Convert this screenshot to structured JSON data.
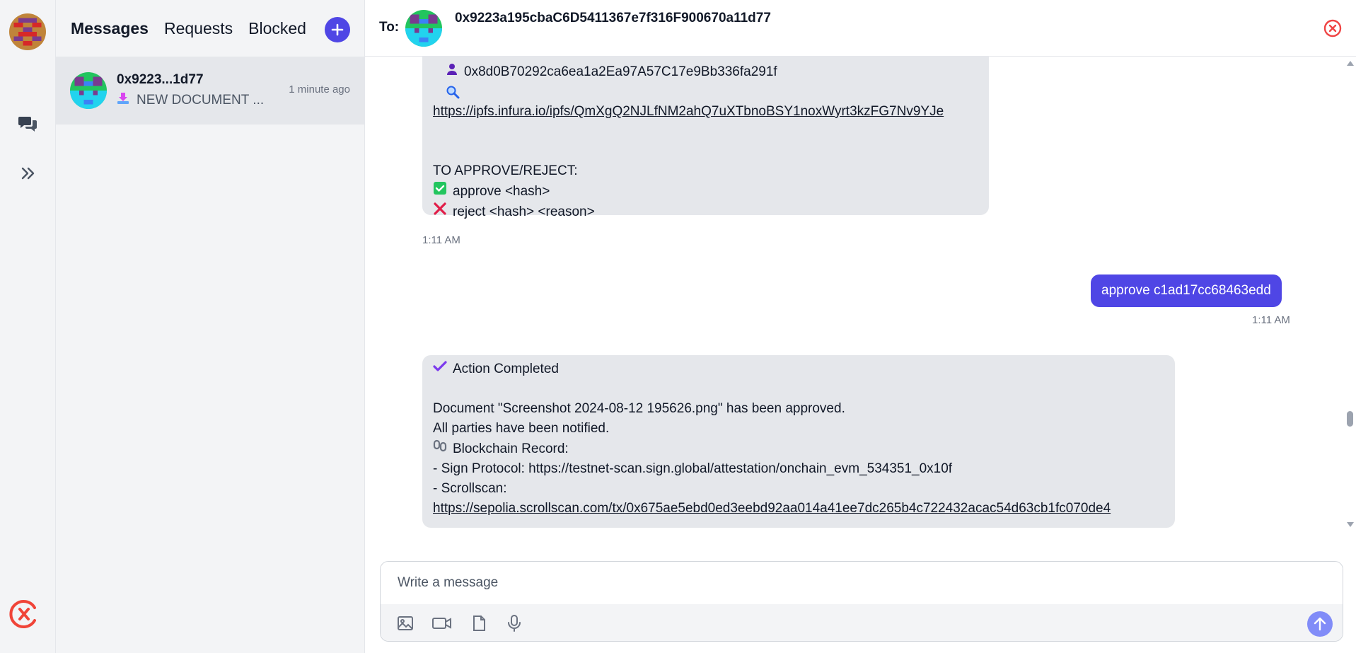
{
  "sidebar": {
    "icons": [
      "user-avatar",
      "chat-bubbles-icon",
      "chevrons-right-icon",
      "xmtp-logo"
    ]
  },
  "conversations": {
    "tabs": [
      "Messages",
      "Requests",
      "Blocked"
    ],
    "active_tab": "Messages",
    "items": [
      {
        "name": "0x9223...1d77",
        "preview": "NEW DOCUMENT ...",
        "time": "1 minute ago"
      }
    ]
  },
  "chat": {
    "to_label": "To:",
    "recipient_address": "0x9223a195cbaC6D5411367e7f316F900670a11d77",
    "messages": [
      {
        "direction": "incoming",
        "signer": "0x8d0B70292ca6ea1a2Ea97A57C17e9Bb336fa291f",
        "link": "https://ipfs.infura.io/ipfs/QmXgQ2NJLfNM2ahQ7uXTbnoBSY1noxWyrt3kzFG7Nv9YJe",
        "instructions_title": "TO APPROVE/REJECT:",
        "approve_line": "approve <hash>",
        "reject_line": "reject <hash> <reason>",
        "time": "1:11 AM"
      },
      {
        "direction": "outgoing",
        "text": "approve c1ad17cc68463edd",
        "time": "1:11 AM"
      },
      {
        "direction": "incoming",
        "title": "Action Completed",
        "line1": "Document \"Screenshot 2024-08-12 195626.png\" has been approved.",
        "line2": "All parties have been notified.",
        "record_label": "Blockchain Record:",
        "sign_protocol": "- Sign Protocol: https://testnet-scan.sign.global/attestation/onchain_evm_534351_0x10f",
        "scrollscan_label": "- Scrollscan:",
        "scrollscan_link": "https://sepolia.scrollscan.com/tx/0x675ae5ebd0ed3eebd92aa014a41ee7dc265b4c722432acac54d63cb1fc070de4"
      }
    ],
    "scroll_position": 0.7
  },
  "composer": {
    "placeholder": "Write a message",
    "tools": [
      "image-icon",
      "video-icon",
      "file-icon",
      "microphone-icon"
    ]
  },
  "colors": {
    "accent": "#4f46e5",
    "bubble_incoming": "#e5e7eb",
    "panel_bg": "#f3f4f6",
    "close_red": "#ef4444"
  }
}
